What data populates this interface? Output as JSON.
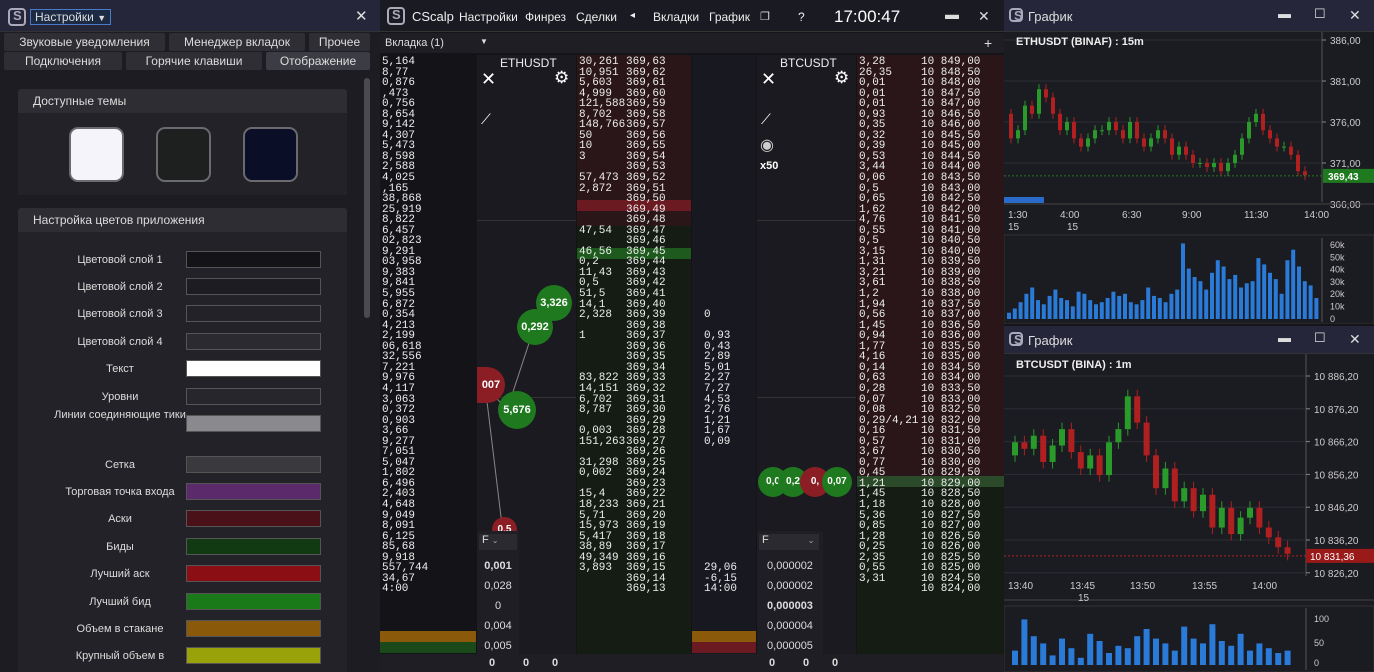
{
  "left": {
    "title_dropdown": "Настройки",
    "close": "✕",
    "tabs_row1": [
      "Звуковые уведомления",
      "Менеджер вкладок",
      "Прочее"
    ],
    "tabs_row2": [
      "Подключения",
      "Горячие клавиши",
      "Отображение"
    ],
    "themes_header": "Доступные темы",
    "themes": [
      {
        "color": "#f4f4fa"
      },
      {
        "color": "#1e2020"
      },
      {
        "color": "#0a0e26"
      }
    ],
    "colors_header": "Настройка цветов приложения",
    "color_rows": [
      {
        "label": "Цветовой слой 1",
        "color": "#141418"
      },
      {
        "label": "Цветовой слой 2",
        "color": "#1c1c22"
      },
      {
        "label": "Цветовой слой 3",
        "color": "#222228"
      },
      {
        "label": "Цветовой слой 4",
        "color": "#2a2a30"
      },
      {
        "label": "Текст",
        "color": "#ffffff"
      },
      {
        "label": "Уровни",
        "color": "#26262c"
      },
      {
        "label": "Линии соединяющие тики",
        "color": "#8a8a8e"
      },
      {
        "label": "Сетка",
        "color": "#3a3a3e"
      },
      {
        "label": "Торговая точка входа",
        "color": "#5a2a6a"
      },
      {
        "label": "Аски",
        "color": "#4a1218"
      },
      {
        "label": "Биды",
        "color": "#123a12"
      },
      {
        "label": "Лучший аск",
        "color": "#8a0e14"
      },
      {
        "label": "Лучший бид",
        "color": "#1a7a1a"
      },
      {
        "label": "Объем в стакане",
        "color": "#8a5a0a"
      },
      {
        "label": "Крупный объем в",
        "color": "#9aa20a"
      }
    ]
  },
  "center": {
    "app": "CScalp",
    "menu": [
      "Настройки",
      "Финрез",
      "Сделки"
    ],
    "menu_arrow": "◂",
    "menu2": [
      "Вкладки",
      "График"
    ],
    "help": "?",
    "time": "17:00:47",
    "tab": "Вкладка (1)",
    "plus": "+",
    "eth_symbol": "ETHUSDT",
    "btc_symbol": "BTCUSDT",
    "btc_mult": "x50",
    "f_label": "F",
    "left_vols": [
      "5,164",
      "8,77",
      "0,876",
      ",473",
      "0,756",
      "8,654",
      "9,142",
      "4,307",
      "5,473",
      "8,598",
      "2,588",
      "4,025",
      ",165",
      "38,868",
      "25,919",
      "8,822",
      "6,457",
      "02,823",
      "9,291",
      "03,958",
      "9,383",
      "9,841",
      "5,955",
      "6,872",
      "0,354",
      "4,213",
      "2,199",
      "06,618",
      "32,556",
      "7,221",
      "9,976",
      "4,117",
      "3,063",
      "0,372",
      "0,903",
      "3,66",
      "9,277",
      "7,051",
      "5,047",
      "1,802",
      "6,496",
      "2,403",
      "4,648",
      "9,049",
      "8,091",
      "6,125",
      "85,68",
      "9,918",
      "557,744",
      "34,67",
      "4:00"
    ],
    "eth_vols": [
      "30,261",
      "10,951",
      "5,603",
      "4,999",
      "121,588",
      "8,702",
      "148,766",
      "50",
      "10",
      "3",
      "",
      "57,473",
      "2,872",
      "",
      "",
      "",
      "47,54",
      "",
      "46,56",
      "0,2",
      "11,43",
      "0,5",
      "51,5",
      "14,1",
      "2,328",
      "",
      "1",
      "",
      "",
      "",
      "83,822",
      "14,151",
      "6,702",
      "8,787",
      "",
      "0,003",
      "151,263",
      "",
      "31,298",
      "0,002",
      "",
      "15,4",
      "18,233",
      "5,71",
      "15,973",
      "5,417",
      "38,89",
      "49,349",
      "3,893",
      ""
    ],
    "eth_prices": [
      "369,63",
      "369,62",
      "369,61",
      "369,60",
      "369,59",
      "369,58",
      "369,57",
      "369,56",
      "369,55",
      "369,54",
      "369,53",
      "369,52",
      "369,51",
      "369,50",
      "369,49",
      "369,48",
      "369,47",
      "369,46",
      "369,45",
      "369,44",
      "369,43",
      "369,42",
      "369,41",
      "369,40",
      "369,39",
      "369,38",
      "369,37",
      "369,36",
      "369,35",
      "369,34",
      "369,33",
      "369,32",
      "369,31",
      "369,30",
      "369,29",
      "369,28",
      "369,27",
      "369,26",
      "369,25",
      "369,24",
      "369,23",
      "369,22",
      "369,21",
      "369,20",
      "369,19",
      "369,18",
      "369,17",
      "369,16",
      "369,15",
      "369,14",
      "369,13"
    ],
    "mid_vals": [
      "",
      "",
      "",
      "",
      "",
      "",
      "",
      "",
      "",
      "",
      "",
      "",
      "",
      "",
      "",
      "",
      "",
      "",
      "",
      "",
      "",
      "",
      "",
      "",
      "0",
      "",
      "0,93",
      "0,43",
      "2,89",
      "5,01",
      "2,27",
      "7,27",
      "4,53",
      "2,76",
      "1,21",
      "1,67",
      "0,09",
      "",
      "",
      "",
      "",
      "",
      "",
      "",
      "",
      "",
      "",
      "",
      "29,06",
      "-6,15",
      "14:00"
    ],
    "btc_vols": [
      "3,28",
      "26,35",
      "0,01",
      "0,01",
      "0,01",
      "0,93",
      "0,35",
      "0,32",
      "0,39",
      "0,53",
      "3,44",
      "0,06",
      "0,5",
      "0,65",
      "1,62",
      "4,76",
      "0,55",
      "0,5",
      "3,15",
      "1,31",
      "3,21",
      "3,61",
      "1,2",
      "1,94",
      "0,56",
      "1,45",
      "0,94",
      "1,77",
      "4,16",
      "0,14",
      "0,63",
      "0,28",
      "0,07",
      "0,08",
      "0,29/4,21",
      "0,16",
      "0,57",
      "3,67",
      "0,77",
      "0,45",
      "1,21",
      "1,45",
      "1,18",
      "5,36",
      "0,85",
      "1,28",
      "0,25",
      "2,35",
      "0,55",
      "3,31"
    ],
    "btc_prices": [
      "10 849,00",
      "10 848,50",
      "10 848,00",
      "10 847,50",
      "10 847,00",
      "10 846,50",
      "10 846,00",
      "10 845,50",
      "10 845,00",
      "10 844,50",
      "10 844,00",
      "10 843,50",
      "10 843,00",
      "10 842,50",
      "10 842,00",
      "10 841,50",
      "10 841,00",
      "10 840,50",
      "10 840,00",
      "10 839,50",
      "10 839,00",
      "10 838,50",
      "10 838,00",
      "10 837,50",
      "10 837,00",
      "10 836,50",
      "10 836,00",
      "10 835,50",
      "10 835,00",
      "10 834,50",
      "10 834,00",
      "10 833,50",
      "10 833,00",
      "10 832,50",
      "10 832,00",
      "10 831,50",
      "10 831,00",
      "10 830,50",
      "10 830,00",
      "10 829,50",
      "10 829,00",
      "10 828,50",
      "10 828,00",
      "10 827,50",
      "10 827,00",
      "10 826,50",
      "10 826,00",
      "10 825,50",
      "10 825,00",
      "10 824,50",
      "10 824,00"
    ],
    "eth_bubbles": [
      "3,326",
      "0,292",
      "007",
      "5,676",
      "0,5"
    ],
    "btc_bubbles": [
      "0,0",
      "0,2",
      "0,",
      "0,07"
    ],
    "eth_lots": [
      "0,001",
      "0,028",
      "0",
      "0,004",
      "0,005"
    ],
    "btc_lots": [
      "0,000002",
      "0,000002",
      "0,000003",
      "0,000004",
      "0,000005"
    ],
    "bottom_zeros": [
      "0",
      "0",
      "0"
    ]
  },
  "eth_chart": {
    "title": "График",
    "label": "ETHUSDT (BINAF) : 15m",
    "price_ticks": [
      "386,00",
      "381,00",
      "376,00",
      "371,00",
      "366,00"
    ],
    "last_price": "369,43",
    "time_ticks": [
      "1:30",
      "4:00",
      "6:30",
      "9:00",
      "11:30",
      "14:00"
    ],
    "date_ticks": [
      "15",
      "15"
    ],
    "vol_ticks": [
      "60k",
      "50k",
      "40k",
      "30k",
      "20k",
      "10k",
      "0"
    ],
    "chart_data": {
      "type": "candlestick",
      "title": "ETHUSDT (BINAF) : 15m",
      "ylim": [
        366,
        386
      ],
      "x": [
        "1:30",
        "4:00",
        "6:30",
        "9:00",
        "11:30",
        "14:00"
      ],
      "last": 369.43,
      "volume_ylim": [
        0,
        60000
      ]
    }
  },
  "btc_chart": {
    "title": "График",
    "label": "BTCUSDT (BINA) : 1m",
    "price_ticks": [
      "10 886,20",
      "10 876,20",
      "10 866,20",
      "10 856,20",
      "10 846,20",
      "10 836,20",
      "10 826,20"
    ],
    "last_price": "10 831,36",
    "time_ticks": [
      "13:40",
      "13:45",
      "13:50",
      "13:55",
      "14:00"
    ],
    "date_ticks": [
      "15"
    ],
    "vol_ticks": [
      "100",
      "50",
      "0"
    ],
    "chart_data": {
      "type": "candlestick",
      "title": "BTCUSDT (BINA) : 1m",
      "ylim": [
        10826.2,
        10886.2
      ],
      "x": [
        "13:40",
        "13:45",
        "13:50",
        "13:55",
        "14:00"
      ],
      "last": 10831.36,
      "volume_ylim": [
        0,
        100
      ]
    }
  }
}
